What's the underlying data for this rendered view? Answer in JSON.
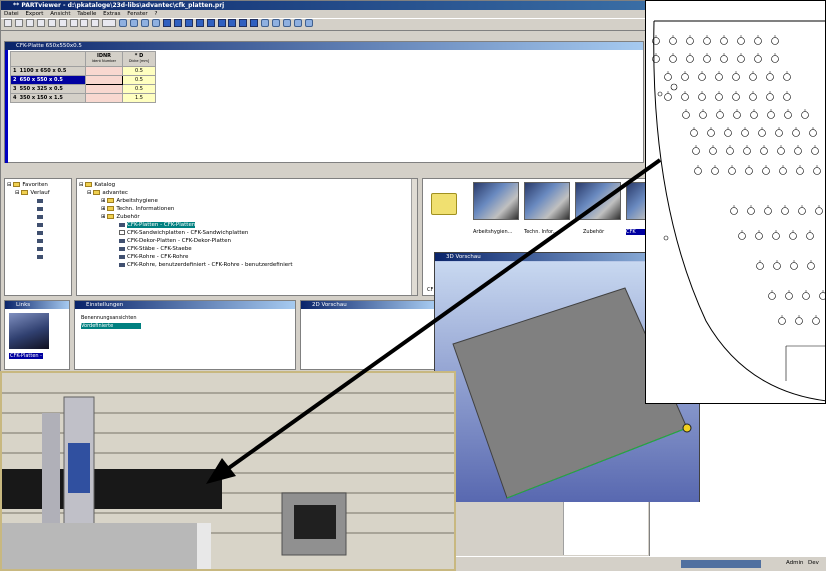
{
  "window": {
    "title": "** PARTviewer - d:\\pkataloge\\23d-libs\\advantec\\cfk_platten.prj",
    "menu": [
      "Datei",
      "Export",
      "Ansicht",
      "Tabelle",
      "Extras",
      "Fenster",
      "?"
    ]
  },
  "table_pane": {
    "title": "CFK-Platte 650x550x0.5",
    "col_idnr": "IDNR",
    "col_idnr_sub": "Ident Number",
    "col_d": "* D",
    "col_d_sub": "Dicke [mm]",
    "rows": [
      {
        "num": "1",
        "name": "1100 x 650 x 0.5",
        "d": "0.5"
      },
      {
        "num": "2",
        "name": "650 x 550 x 0.5",
        "d": "0.5"
      },
      {
        "num": "3",
        "name": "550 x 325 x 0.5",
        "d": "0.5"
      },
      {
        "num": "4",
        "name": "350 x 150 x 1.5",
        "d": "1.5"
      }
    ]
  },
  "favorites_tree": {
    "root": "Favoriten",
    "child": "Verlauf"
  },
  "catalog_tree": {
    "items": [
      "Katalog",
      "advantec",
      "Arbeitshygiene",
      "Techn. Informationen",
      "Zubehör",
      "CFK-Platten - CFK-Platten",
      "CFK-Sandwichplatten - CFK-Sandwichplatten",
      "CFK-Dekor-Platten - CFK-Dekor-Platten",
      "CFK-Stäbe - CFK-Staebe",
      "CFK-Rohre - CFK-Rohre",
      "CFK-Rohre, benutzerdefiniert - CFK-Rohre - benutzerdefiniert"
    ]
  },
  "thumbnails": {
    "captions": [
      "Arbeitshygien...",
      "Techn. Infor...",
      "Zubehör",
      "CFK"
    ],
    "bottom_caption": "CF"
  },
  "links_pane": {
    "title": "Links",
    "caption": "CFK-Platten -"
  },
  "settings_pane": {
    "title": "Einstellungen",
    "line1": "Benennungsansichten",
    "line2": "Vordefinierte"
  },
  "preview2d": {
    "title": "2D Vorschau"
  },
  "preview3d": {
    "title": "3D Vorschau"
  },
  "status": {
    "user": "Admin",
    "extra": "Dev"
  },
  "colors": {
    "accent": "#0a246a",
    "selection": "#0000a0",
    "plate": "#808080",
    "preview_bg": "#b8c8e8"
  }
}
